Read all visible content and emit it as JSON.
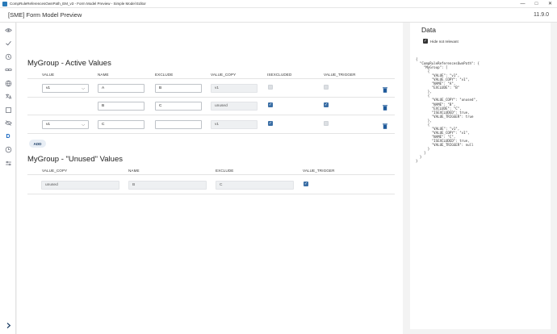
{
  "window": {
    "title": "CompRuleReferencesOwnPath_EM_v3 - Form Model Preview - Simple Model Editor",
    "controls": {
      "minimize": "—",
      "maximize": "□",
      "close": "✕"
    }
  },
  "header": {
    "title": "[SME] Form Model Preview",
    "version": "11.9.0"
  },
  "sidebar": {
    "icons": [
      "eye-icon",
      "check-icon",
      "history-icon",
      "link-icon",
      "globe-icon",
      "translate-icon",
      "square-icon",
      "hidden-icon",
      "d-icon",
      "clock-icon",
      "sliders-icon",
      "expand-icon"
    ],
    "d_label": "D"
  },
  "active_section": {
    "title": "MyGroup - Active Values",
    "columns": [
      "VALUE",
      "NAME",
      "EXCLUDE",
      "VALUE_COPY",
      "ISEXCLUDED",
      "VALUE_TRIGGER"
    ],
    "rows": [
      {
        "value": "v1",
        "has_select": true,
        "name": "A",
        "exclude": "B",
        "value_copy": "v1",
        "isexcluded": false,
        "value_trigger": false
      },
      {
        "value": "",
        "has_select": false,
        "name": "B",
        "exclude": "C",
        "value_copy": "unused",
        "isexcluded": true,
        "value_trigger": true
      },
      {
        "value": "v1",
        "has_select": true,
        "name": "C",
        "exclude": "",
        "value_copy": "v1",
        "isexcluded": true,
        "value_trigger": false
      }
    ],
    "add_label": "ADD"
  },
  "unused_section": {
    "title": "MyGroup - \"Unused\" Values",
    "columns": [
      "VALUE_COPY",
      "NAME",
      "EXCLUDE",
      "VALUE_TRIGGER"
    ],
    "rows": [
      {
        "value_copy": "unused",
        "name": "B",
        "exclude": "C",
        "value_trigger": true
      }
    ]
  },
  "data_panel": {
    "title": "Data",
    "hide_label": "Hide not relevant",
    "hide_checked": true,
    "json_lines": [
      "{",
      "  \"CompRuleReferencesOwnPath\": {",
      "    \"MyGroup\": [",
      "      {",
      "        \"VALUE\": \"v1\",",
      "        \"VALUE_COPY\": \"v1\",",
      "        \"NAME\": \"A\",",
      "        \"EXCLUDE\": \"B\"",
      "      },",
      "      {",
      "        \"VALUE_COPY\": \"unused\",",
      "        \"NAME\": \"B\",",
      "        \"EXCLUDE\": \"C\",",
      "        \"ISEXCLUDED\": true,",
      "        \"VALUE_TRIGGER\": true",
      "      },",
      "      {",
      "        \"VALUE\": \"v1\",",
      "        \"VALUE_COPY\": \"v1\",",
      "        \"NAME\": \"C\",",
      "        \"ISEXCLUDED\": true,",
      "        \"VALUE_TRIGGER\": null",
      "      }",
      "    ]",
      "  }",
      "}"
    ]
  },
  "colors": {
    "accent": "#1565c0",
    "checkbox_on": "#3a6ea5",
    "trash": "#1f5a9a"
  }
}
